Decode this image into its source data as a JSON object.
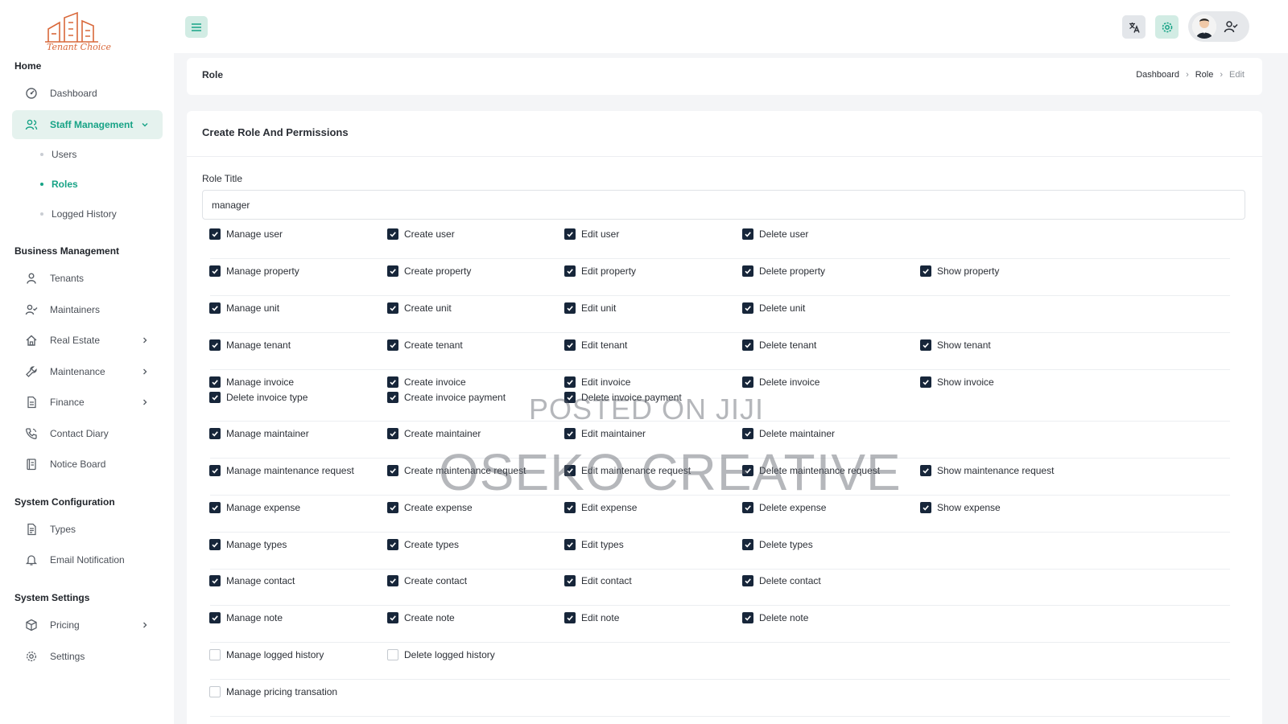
{
  "brand": {
    "logo_text": "Tenant Choice",
    "accent": "#17a386",
    "checkbox_color": "#17263a"
  },
  "sidebar": {
    "sections": [
      {
        "title": "Home"
      },
      {
        "title": "Business Management"
      },
      {
        "title": "System Configuration"
      },
      {
        "title": "System Settings"
      }
    ],
    "items": [
      {
        "label": "Dashboard",
        "icon": "dashboard-icon"
      },
      {
        "label": "Staff Management",
        "icon": "users-icon",
        "active": true,
        "expanded": true
      },
      {
        "label": "Tenants",
        "icon": "person-icon"
      },
      {
        "label": "Maintainers",
        "icon": "user-check-icon"
      },
      {
        "label": "Real Estate",
        "icon": "home-icon"
      },
      {
        "label": "Maintenance",
        "icon": "wrench-icon"
      },
      {
        "label": "Finance",
        "icon": "file-icon"
      },
      {
        "label": "Contact Diary",
        "icon": "phone-icon"
      },
      {
        "label": "Notice Board",
        "icon": "board-icon"
      },
      {
        "label": "Types",
        "icon": "document-icon"
      },
      {
        "label": "Email Notification",
        "icon": "bell-icon"
      },
      {
        "label": "Pricing",
        "icon": "package-icon"
      },
      {
        "label": "Settings",
        "icon": "gear-icon"
      }
    ],
    "sub_items": [
      {
        "label": "Users"
      },
      {
        "label": "Roles",
        "active": true
      },
      {
        "label": "Logged History"
      }
    ]
  },
  "topbar": {
    "menu_icon": "hamburger-icon",
    "language_icon": "translate-icon",
    "settings_icon": "gear-icon",
    "user_icon": "user-check-icon"
  },
  "header": {
    "title": "Role",
    "breadcrumb": [
      "Dashboard",
      "Role",
      "Edit"
    ]
  },
  "form": {
    "card_title": "Create Role And Permissions",
    "role_title_label": "Role Title",
    "role_title_value": "manager"
  },
  "permissions": [
    [
      {
        "label": "Manage user",
        "checked": true
      },
      {
        "label": "Create user",
        "checked": true
      },
      {
        "label": "Edit user",
        "checked": true
      },
      {
        "label": "Delete user",
        "checked": true
      }
    ],
    [
      {
        "label": "Manage property",
        "checked": true
      },
      {
        "label": "Create property",
        "checked": true
      },
      {
        "label": "Edit property",
        "checked": true
      },
      {
        "label": "Delete property",
        "checked": true
      },
      {
        "label": "Show property",
        "checked": true
      }
    ],
    [
      {
        "label": "Manage unit",
        "checked": true
      },
      {
        "label": "Create unit",
        "checked": true
      },
      {
        "label": "Edit unit",
        "checked": true
      },
      {
        "label": "Delete unit",
        "checked": true
      }
    ],
    [
      {
        "label": "Manage tenant",
        "checked": true
      },
      {
        "label": "Create tenant",
        "checked": true
      },
      {
        "label": "Edit tenant",
        "checked": true
      },
      {
        "label": "Delete tenant",
        "checked": true
      },
      {
        "label": "Show tenant",
        "checked": true
      }
    ],
    [
      {
        "label": "Manage invoice",
        "checked": true
      },
      {
        "label": "Create invoice",
        "checked": true
      },
      {
        "label": "Edit invoice",
        "checked": true
      },
      {
        "label": "Delete invoice",
        "checked": true
      },
      {
        "label": "Show invoice",
        "checked": true
      },
      {
        "label": "Delete invoice type",
        "checked": true
      },
      {
        "label": "Create invoice payment",
        "checked": true
      },
      {
        "label": "Delete invoice payment",
        "checked": true
      }
    ],
    [
      {
        "label": "Manage maintainer",
        "checked": true
      },
      {
        "label": "Create maintainer",
        "checked": true
      },
      {
        "label": "Edit maintainer",
        "checked": true
      },
      {
        "label": "Delete maintainer",
        "checked": true
      }
    ],
    [
      {
        "label": "Manage maintenance request",
        "checked": true
      },
      {
        "label": "Create maintenance request",
        "checked": true
      },
      {
        "label": "Edit maintenance request",
        "checked": true
      },
      {
        "label": "Delete maintenance request",
        "checked": true
      },
      {
        "label": "Show maintenance request",
        "checked": true
      }
    ],
    [
      {
        "label": "Manage expense",
        "checked": true
      },
      {
        "label": "Create expense",
        "checked": true
      },
      {
        "label": "Edit expense",
        "checked": true
      },
      {
        "label": "Delete expense",
        "checked": true
      },
      {
        "label": "Show expense",
        "checked": true
      }
    ],
    [
      {
        "label": "Manage types",
        "checked": true
      },
      {
        "label": "Create types",
        "checked": true
      },
      {
        "label": "Edit types",
        "checked": true
      },
      {
        "label": "Delete types",
        "checked": true
      }
    ],
    [
      {
        "label": "Manage contact",
        "checked": true
      },
      {
        "label": "Create contact",
        "checked": true
      },
      {
        "label": "Edit contact",
        "checked": true
      },
      {
        "label": "Delete contact",
        "checked": true
      }
    ],
    [
      {
        "label": "Manage note",
        "checked": true
      },
      {
        "label": "Create note",
        "checked": true
      },
      {
        "label": "Edit note",
        "checked": true
      },
      {
        "label": "Delete note",
        "checked": true
      }
    ],
    [
      {
        "label": "Manage logged history",
        "checked": false
      },
      {
        "label": "Delete logged history",
        "checked": false
      }
    ],
    [
      {
        "label": "Manage pricing transation",
        "checked": false
      }
    ]
  ],
  "watermark": {
    "line1": "POSTED ON JIJI",
    "line2": "OSEKO CREATIVE"
  }
}
